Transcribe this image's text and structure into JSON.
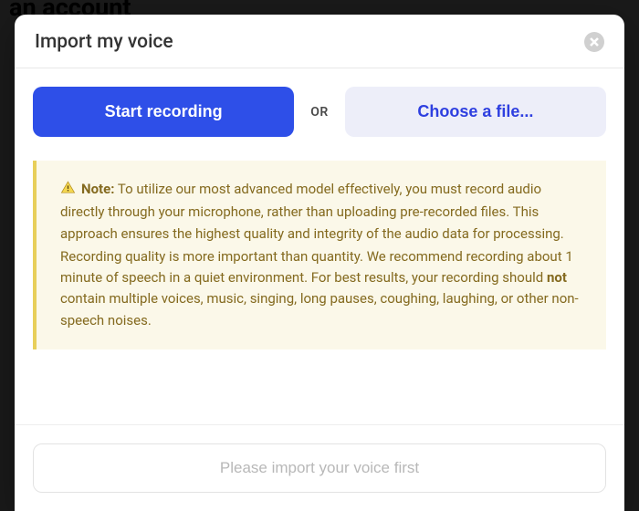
{
  "backdrop_text": "an account",
  "modal": {
    "title": "Import my voice",
    "start_recording_label": "Start recording",
    "or_label": "OR",
    "choose_file_label": "Choose a file...",
    "note": {
      "label": "Note:",
      "paragraph1": " To utilize our most advanced model effectively, you must record audio directly through your microphone, rather than uploading pre-recorded files. This approach ensures the highest quality and integrity of the audio data for processing.",
      "paragraph2_a": "Recording quality is more important than quantity. We recommend recording about 1 minute of speech in a quiet environment. For best results, your recording should ",
      "paragraph2_bold": "not",
      "paragraph2_b": " contain multiple voices, music, singing, long pauses, coughing, laughing, or other non-speech noises."
    },
    "footer_button_label": "Please import your voice first"
  }
}
